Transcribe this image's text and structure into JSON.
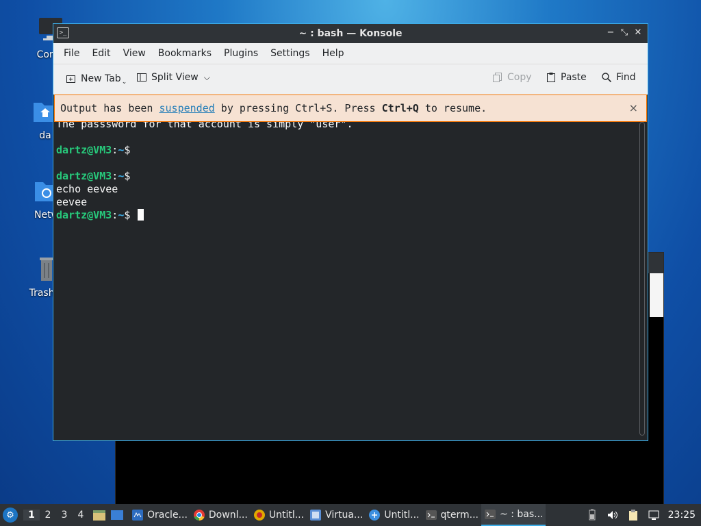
{
  "desktop": {
    "icons": [
      {
        "label": "Comp"
      },
      {
        "label": "da"
      },
      {
        "label": "Netw"
      },
      {
        "label": "Trash (l"
      }
    ]
  },
  "window": {
    "title": "~ : bash — Konsole",
    "menu": [
      "File",
      "Edit",
      "View",
      "Bookmarks",
      "Plugins",
      "Settings",
      "Help"
    ],
    "toolbar": {
      "new_tab": "New Tab",
      "split_view": "Split View",
      "copy": "Copy",
      "paste": "Paste",
      "find": "Find"
    },
    "notice": {
      "prefix": "Output has been ",
      "link": "suspended",
      "middle": " by pressing Ctrl+S. Press ",
      "key": "Ctrl+Q",
      "suffix": " to resume.",
      "close": "×"
    },
    "terminal": {
      "partial_line": "The passsword for that account is simply \"user\".",
      "prompt_user": "dartz@VM3",
      "prompt_sep": ":",
      "prompt_path": "~",
      "prompt_dollar": "$",
      "command": "echo eevee",
      "output": "eevee"
    }
  },
  "taskbar": {
    "workspaces": [
      "1",
      "2",
      "3",
      "4"
    ],
    "active_workspace": "1",
    "tasks": [
      {
        "label": "Oracle...",
        "icon": "virtualbox-icon",
        "color": "#2d6cc0"
      },
      {
        "label": "Downl...",
        "icon": "chrome-icon",
        "color": "#e53935"
      },
      {
        "label": "Untitl...",
        "icon": "record-icon",
        "color": "#e0a800"
      },
      {
        "label": "Virtua...",
        "icon": "virtualbox-manager-icon",
        "color": "#5a8fd6"
      },
      {
        "label": "Untitl...",
        "icon": "app-icon",
        "color": "#3b8fe0"
      },
      {
        "label": "qterm...",
        "icon": "terminal-icon",
        "color": "#555"
      },
      {
        "label": "~ : bas...",
        "icon": "terminal-icon",
        "color": "#555"
      }
    ],
    "clock": "23:25"
  }
}
